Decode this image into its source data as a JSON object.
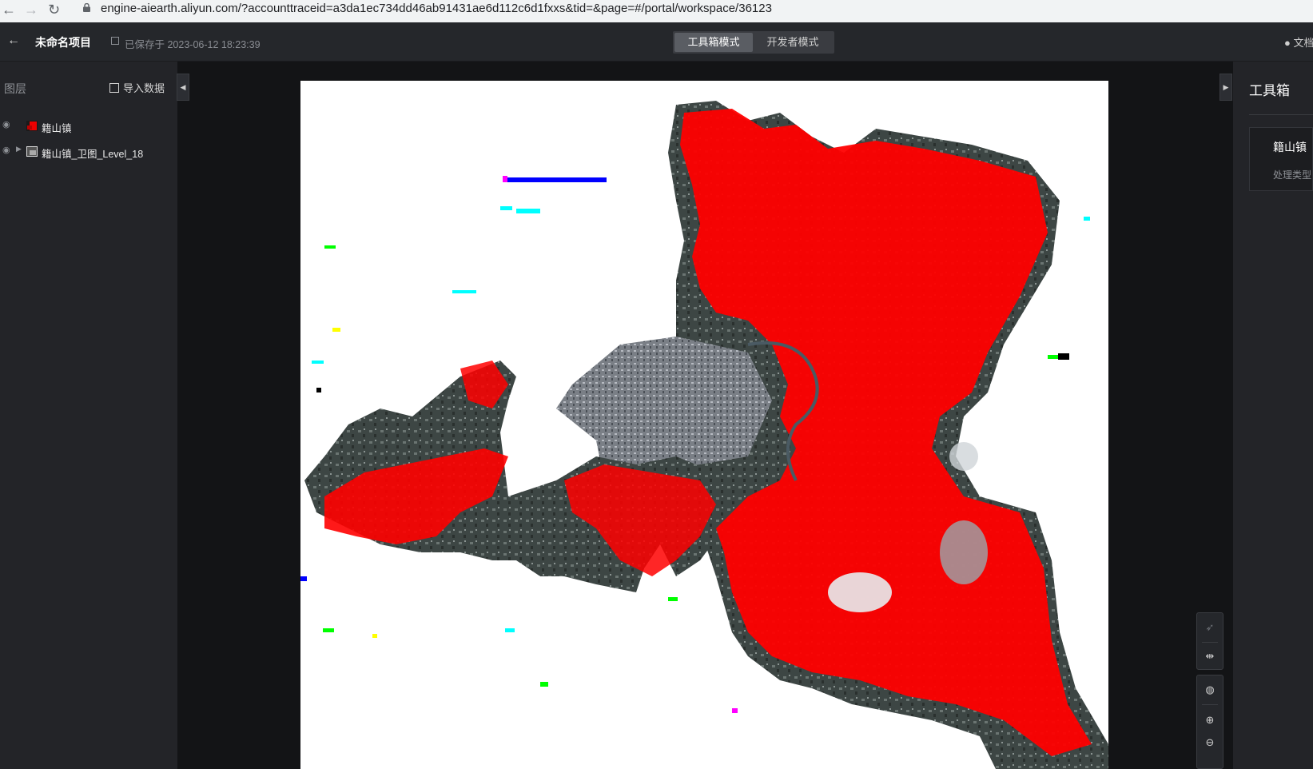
{
  "browser": {
    "url": "engine-aiearth.aliyun.com/?accounttraceid=a3da1ec734dd46ab91431ae6d112c6d1fxxs&tid=&page=#/portal/workspace/36123"
  },
  "header": {
    "project_name": "未命名项目",
    "saved_text": "已保存于 2023-06-12 18:23:39",
    "mode_toolbox": "工具箱模式",
    "mode_developer": "开发者模式",
    "docs_partial": "文档"
  },
  "layers_panel": {
    "title": "图层",
    "import_label": "导入数据",
    "layers": [
      {
        "name": "籍山镇"
      },
      {
        "name": "籍山镇_卫图_Level_18"
      }
    ]
  },
  "toolbox_panel": {
    "title": "工具箱",
    "card_title": "籍山镇",
    "card_subtitle": "处理类型"
  },
  "icons": {
    "back": "arrow-left-icon",
    "eye": "eye-icon",
    "save": "save-icon",
    "import": "import-icon",
    "bulb": "lightbulb-icon",
    "globe": "globe-icon",
    "zoom_in": "zoom-in-icon",
    "zoom_out": "zoom-out-icon",
    "split": "split-view-icon",
    "pointer": "pointer-icon"
  },
  "colors": {
    "classification_red": "#ff0000",
    "panel_bg": "#232428",
    "map_bg": "#131416"
  }
}
